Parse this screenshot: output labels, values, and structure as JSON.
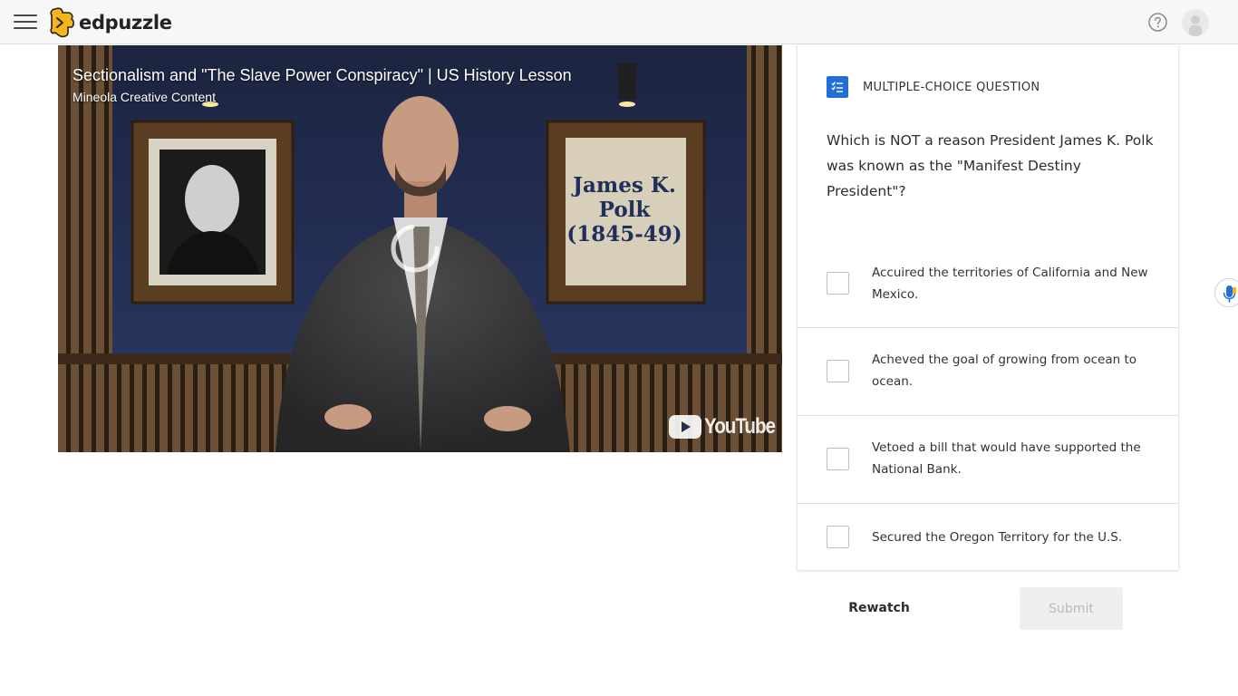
{
  "header": {
    "app_name": "edpuzzle",
    "icons": [
      "hamburger-menu-icon",
      "edpuzzle-logo-icon",
      "help-icon",
      "avatar-icon"
    ]
  },
  "video": {
    "title": "Sectionalism and \"The Slave Power Conspiracy\" | US History Lesson",
    "channel": "Mineola Creative Content",
    "frame_caption_lines": [
      "James K.",
      "Polk",
      "(1845-49)"
    ],
    "platform_label": "YouTube"
  },
  "question": {
    "type_label": "MULTIPLE-CHOICE QUESTION",
    "text": "Which is NOT a reason President James K. Polk was known as the \"Manifest Destiny President\"?",
    "options": [
      {
        "label": "Accuired the territories of California and New Mexico.",
        "checked": false
      },
      {
        "label": "Acheved the goal of growing from ocean to ocean.",
        "checked": false
      },
      {
        "label": "Vetoed a bill that would have supported the National Bank.",
        "checked": false
      },
      {
        "label": "Secured the Oregon Territory for the U.S.",
        "checked": false
      }
    ]
  },
  "actions": {
    "rewatch_label": "Rewatch",
    "submit_label": "Submit"
  },
  "colors": {
    "accent_blue": "#1f6fd6",
    "logo_yellow": "#f6b51b",
    "submit_disabled_bg": "#efefef"
  }
}
